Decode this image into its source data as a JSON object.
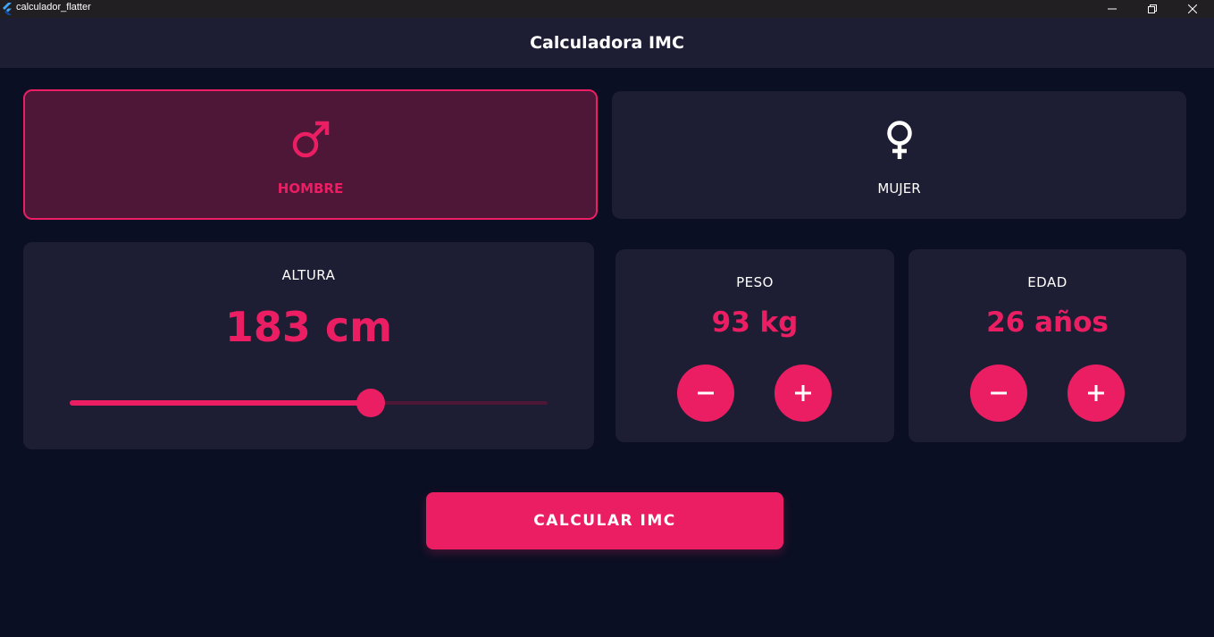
{
  "window": {
    "title": "calculador_flatter",
    "app_icon": "flutter-logo-icon",
    "controls": [
      "minimize-icon",
      "restore-icon",
      "close-icon"
    ]
  },
  "appbar": {
    "title": "Calculadora IMC"
  },
  "gender": {
    "male": {
      "label": "HOMBRE",
      "icon": "male-symbol-icon",
      "selected": true
    },
    "female": {
      "label": "MUJER",
      "icon": "female-symbol-icon",
      "selected": false
    }
  },
  "height": {
    "label": "ALTURA",
    "value_text": "183 cm",
    "slider_fraction": 0.63
  },
  "weight": {
    "label": "PESO",
    "value_text": "93 kg",
    "decrement_icon": "minus-icon",
    "increment_icon": "plus-icon"
  },
  "age": {
    "label": "EDAD",
    "value_text": "26 años",
    "decrement_icon": "minus-icon",
    "increment_icon": "plus-icon"
  },
  "calculate_button": {
    "label": "CALCULAR IMC"
  },
  "colors": {
    "background": "#0b0f23",
    "card": "#1d1e33",
    "accent": "#eb1e63",
    "selected_card": "#4e1637",
    "titlebar": "#221f22",
    "text": "#ffffff"
  }
}
